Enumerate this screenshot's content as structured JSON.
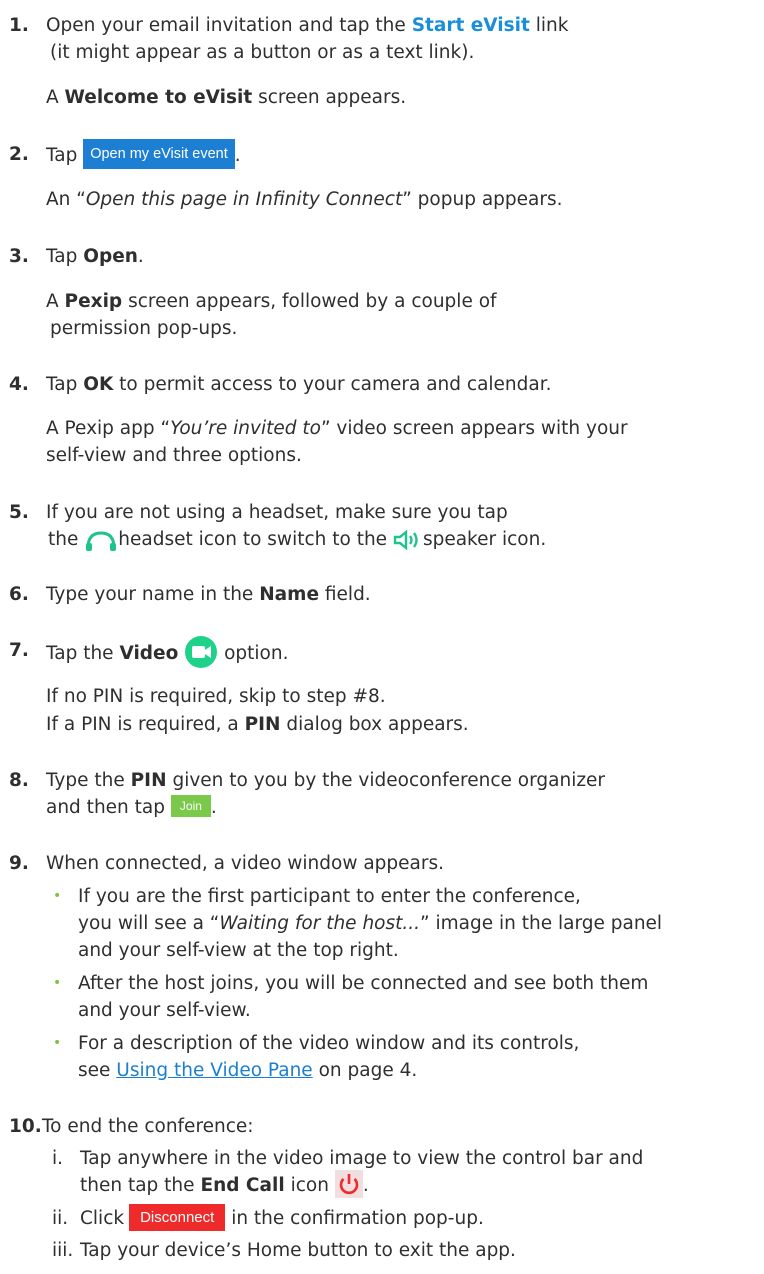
{
  "steps": [
    {
      "num": "1.",
      "a": "Open your email invitation and tap the",
      "b": "Start eVisit",
      "c": "link",
      "d": "(it might appear as a button or as a text link).",
      "e_pre": "A",
      "e_bold": "Welcome to eVisit",
      "e_post": "screen appears."
    },
    {
      "num": "2.",
      "a": "Tap",
      "button": "Open my eVisit event",
      "after": ".",
      "b_pre": "An “",
      "b_ital": "Open this page in Infinity Connect",
      "b_post": "” popup appears."
    },
    {
      "num": "3.",
      "a": "Tap",
      "b": "Open",
      "c": ".",
      "d_pre": "A",
      "d_bold": "Pexip",
      "d_post": "screen appears, followed by a couple of",
      "e": "permission pop-ups."
    },
    {
      "num": "4.",
      "a": "Tap",
      "b": "OK",
      "c": "to permit access to your camera and calendar.",
      "d_pre": "A Pexip app “",
      "d_ital": "You’re invited to",
      "d_post": "” video screen appears with your",
      "e": "self-view and three options."
    },
    {
      "num": "5.",
      "a": "If you are not using a headset, make sure you tap",
      "b_pre": "the",
      "b_mid": "headset icon to switch to the",
      "b_post": "speaker icon."
    },
    {
      "num": "6.",
      "a": "Type your name in the",
      "b": "Name",
      "c": "field."
    },
    {
      "num": "7.",
      "a": "Tap the",
      "b": "Video",
      "c": "option.",
      "d": "If no PIN is required, skip to step #8.",
      "e_pre": "If a PIN is required, a",
      "e_bold": "PIN",
      "e_post": "dialog box appears."
    },
    {
      "num": "8.",
      "a": "Type the",
      "b": "PIN",
      "c": "given to you by the videoconference organizer",
      "d": "and then tap",
      "button": "Join",
      "after": "."
    },
    {
      "num": "9.",
      "a": "When connected, a video window appears.",
      "bullet1_a_pre": "If you are the first participant to enter the conference,",
      "bullet1_b_pre": "you will see a “",
      "bullet1_b_ital": "Waiting for the host...",
      "bullet1_b_post": "” image in the large panel",
      "bullet1_c": "and your self-view at the top right.",
      "bullet2_a": "After the host joins, you will be connected and see both them",
      "bullet2_b": "and your self-view.",
      "bullet3_a": "For a description of the video window and its controls,",
      "bullet3_b_pre": "see",
      "bullet3_link": "Using the Video Pane",
      "bullet3_b_post": "on page 4."
    },
    {
      "num": "10.",
      "a": "To end the conference:",
      "r1_num": "i.",
      "r1_a": "Tap anywhere in the video image to view the control bar and",
      "r1_b_pre": "then tap the",
      "r1_b_bold": "End Call",
      "r1_b_post": "icon",
      "r1_after": ".",
      "r2_num": "ii.",
      "r2_a": "Click",
      "r2_button": "Disconnect",
      "r2_b": "in the confirmation pop-up.",
      "r3_num": "iii.",
      "r3_a": "Tap your device’s Home button to exit the app."
    }
  ],
  "icons": {
    "headset": "headset-icon",
    "speaker": "speaker-icon",
    "video": "video-camera-icon",
    "end_call": "power-icon"
  },
  "colors": {
    "link_blue": "#1a8fd8",
    "button_blue": "#1d7fd3",
    "join_green": "#7bc94a",
    "disconnect_red": "#ef2a2a",
    "video_green": "#1fd28a",
    "bullet_green": "#7dc24a"
  }
}
